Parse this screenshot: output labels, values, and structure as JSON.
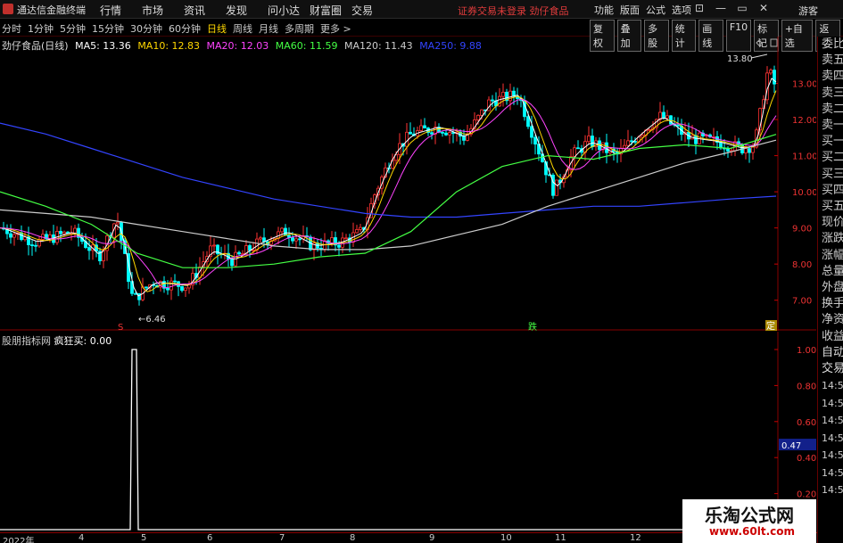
{
  "titlebar": {
    "app_name": "通达信金融终端",
    "menu": [
      "行情",
      "市场",
      "资讯",
      "发现",
      "问小达",
      "财富圈",
      "交易"
    ],
    "notice": "证券交易未登录  劲仔食品",
    "right_menu": [
      "功能",
      "版面",
      "公式",
      "选项"
    ],
    "window_buttons": [
      "⊡",
      "—",
      "▭",
      "✕"
    ],
    "guest": "游客"
  },
  "periodbar": {
    "periods": [
      "分时",
      "1分钟",
      "5分钟",
      "15分钟",
      "30分钟",
      "60分钟",
      "日线",
      "周线",
      "月线",
      "多周期",
      "更多 >"
    ],
    "active": "日线",
    "tools": [
      "复权",
      "叠加",
      "多股",
      "统计",
      "画线",
      "F10",
      "标记",
      "+自选",
      "返回"
    ]
  },
  "legend": {
    "stock": "劲仔食品(日线)",
    "ma": [
      {
        "label": "MA5: 13.36",
        "color": "#ffffff"
      },
      {
        "label": "MA10: 12.83",
        "color": "#ffd700"
      },
      {
        "label": "MA20: 12.03",
        "color": "#ff44ff"
      },
      {
        "label": "MA60: 11.59",
        "color": "#44ff44"
      },
      {
        "label": "MA120: 11.43",
        "color": "#cccccc"
      },
      {
        "label": "MA250: 9.88",
        "color": "#3344ff"
      }
    ]
  },
  "price_axis": [
    "13.00",
    "12.00",
    "11.00",
    "10.00",
    "9.00",
    "8.00",
    "7.00"
  ],
  "annotations": {
    "high": "13.80",
    "low": "6.46",
    "mark_s": "S",
    "mark_die": "跌",
    "mark_ding": "定"
  },
  "quote_panel": {
    "labels": [
      "委比",
      "卖五",
      "卖四",
      "卖三",
      "卖二",
      "卖一",
      "买一",
      "买二",
      "买三",
      "买四",
      "买五",
      "现价",
      "涨跌",
      "涨幅",
      "总量",
      "外盘",
      "换手",
      "净资",
      "收益",
      "自动",
      "交易"
    ],
    "times": [
      "14:56",
      "14:56",
      "14:56",
      "14:56",
      "14:56",
      "14:56",
      "14:56"
    ]
  },
  "indicator": {
    "name": "股朋指标网",
    "value_label": "疯狂买: 0.00",
    "axis": [
      "1.00",
      "0.80",
      "0.60",
      "0.47",
      "0.40",
      "0.20"
    ],
    "current": "0.47"
  },
  "date_axis": [
    "2022年",
    "4",
    "5",
    "6",
    "7",
    "8",
    "9",
    "10",
    "11",
    "12"
  ],
  "watermark": {
    "title": "乐淘公式网",
    "url": "www.60lt.com"
  },
  "colors": {
    "up": "#ff3333",
    "down": "#00ffff",
    "ma5": "#ffffff",
    "ma10": "#ffd700",
    "ma20": "#ff44ff",
    "ma60": "#44ff44",
    "ma120": "#cccccc",
    "ma250": "#3344ff"
  },
  "chart_data": {
    "type": "line",
    "title": "劲仔食品(日线)",
    "series": [
      {
        "name": "MA250",
        "values": [
          11.9,
          11.6,
          11.2,
          10.8,
          10.4,
          10.1,
          9.8,
          9.6,
          9.4,
          9.3,
          9.3,
          9.4,
          9.5,
          9.6,
          9.6,
          9.7,
          9.8,
          9.88
        ]
      },
      {
        "name": "MA120",
        "values": [
          9.5,
          9.4,
          9.3,
          9.1,
          8.9,
          8.7,
          8.5,
          8.4,
          8.4,
          8.5,
          8.8,
          9.1,
          9.6,
          10.0,
          10.4,
          10.8,
          11.1,
          11.43
        ]
      },
      {
        "name": "MA60",
        "values": [
          10.0,
          9.6,
          9.1,
          8.3,
          7.9,
          7.9,
          8.0,
          8.2,
          8.3,
          8.9,
          10.0,
          10.7,
          11.0,
          10.9,
          11.2,
          11.3,
          11.2,
          11.59
        ]
      }
    ],
    "ylim": [
      6.4,
      14.0
    ],
    "x_labels": [
      "2022年",
      "4",
      "5",
      "6",
      "7",
      "8",
      "9",
      "10",
      "11",
      "12"
    ],
    "high": 13.8,
    "low": 6.46
  }
}
